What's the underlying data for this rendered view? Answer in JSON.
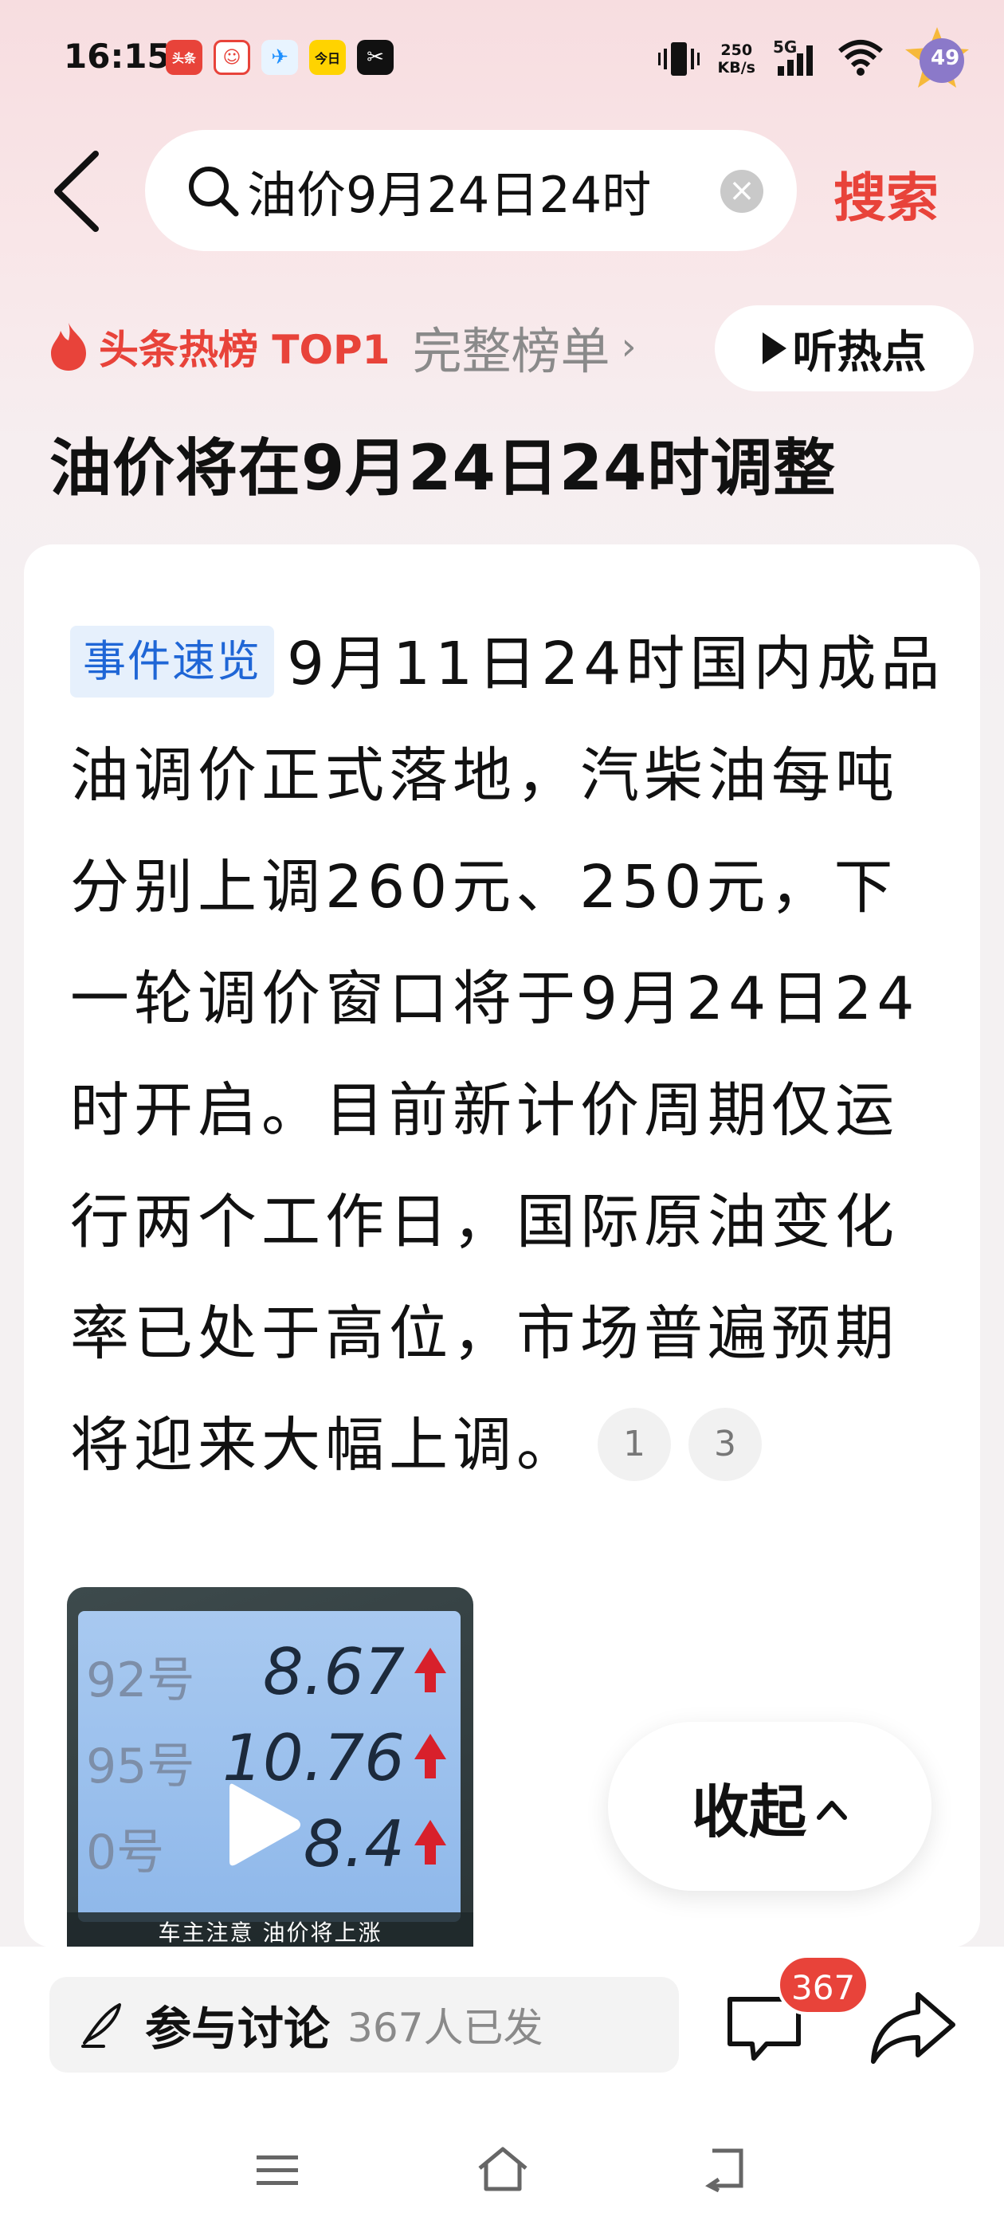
{
  "status_bar": {
    "time": "16:15",
    "app_icons": [
      {
        "name": "toutiao-app-icon",
        "glyph": "头条"
      },
      {
        "name": "face-app-icon",
        "glyph": "☺"
      },
      {
        "name": "plane-app-icon",
        "glyph": "✈"
      },
      {
        "name": "jinri-app-icon",
        "glyph": "今日"
      },
      {
        "name": "capcut-app-icon",
        "glyph": "✂"
      }
    ],
    "net_speed_value": "250",
    "net_speed_unit": "KB/s",
    "network_type": "5G",
    "battery": "49"
  },
  "search": {
    "query": "油价9月24日24时",
    "button_label": "搜索"
  },
  "hot": {
    "label": "头条热榜 TOP1",
    "full_list_label": "完整榜单",
    "listen_label": "听热点"
  },
  "page_title": "油价将在9月24日24时调整",
  "card": {
    "tag": "事件速览",
    "body": "9月11日24时国内成品油调价正式落地，汽柴油每吨分别上调260元、250元，下一轮调价窗口将于9月24日24时开启。目前新计价周期仅运行两个工作日，国际原油变化率已处于高位，市场普遍预期将迎来大幅上调。",
    "refs": [
      "1",
      "3"
    ],
    "video": {
      "rows": [
        {
          "grade": "92号",
          "price": "8.67"
        },
        {
          "grade": "95号",
          "price": "10.76"
        },
        {
          "grade": "0号",
          "price": "8.4"
        }
      ],
      "caption": "车主注意 油价将上涨"
    },
    "collapse_label": "收起"
  },
  "bottom": {
    "discuss_label": "参与讨论",
    "count_label": "367人已发",
    "comment_badge": "367"
  },
  "colors": {
    "accent_red": "#e8433a",
    "tag_blue": "#1f66d6",
    "tag_bg": "#e6f0fc"
  }
}
